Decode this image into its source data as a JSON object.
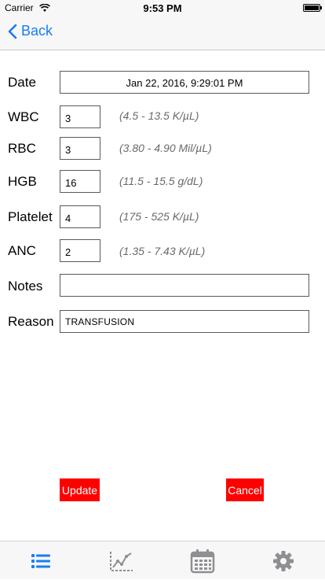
{
  "status_bar": {
    "carrier": "Carrier",
    "time": "9:53 PM"
  },
  "nav": {
    "back_label": "Back"
  },
  "form": {
    "date": {
      "label": "Date",
      "value": "Jan 22, 2016, 9:29:01 PM"
    },
    "wbc": {
      "label": "WBC",
      "value": "3",
      "range": "(4.5 - 13.5 K/µL)"
    },
    "rbc": {
      "label": "RBC",
      "value": "3",
      "range": "(3.80 - 4.90 Mil/µL)"
    },
    "hgb": {
      "label": "HGB",
      "value": "16",
      "range": "(11.5 - 15.5 g/dL)"
    },
    "platelet": {
      "label": "Platelet",
      "value": "4",
      "range": "(175 - 525 K/µL)"
    },
    "anc": {
      "label": "ANC",
      "value": "2",
      "range": "(1.35 - 7.43 K/µL)"
    },
    "notes": {
      "label": "Notes",
      "value": ""
    },
    "reason": {
      "label": "Reason",
      "value": "TRANSFUSION"
    }
  },
  "buttons": {
    "update": "Update",
    "cancel": "Cancel"
  },
  "tabs": [
    {
      "icon": "list-icon",
      "active": true
    },
    {
      "icon": "chart-icon",
      "active": false
    },
    {
      "icon": "calendar-icon",
      "active": false
    },
    {
      "icon": "gear-icon",
      "active": false
    }
  ],
  "colors": {
    "accent": "#1a7cf5",
    "button": "#ff0000",
    "tab_inactive": "#8e8e93"
  }
}
